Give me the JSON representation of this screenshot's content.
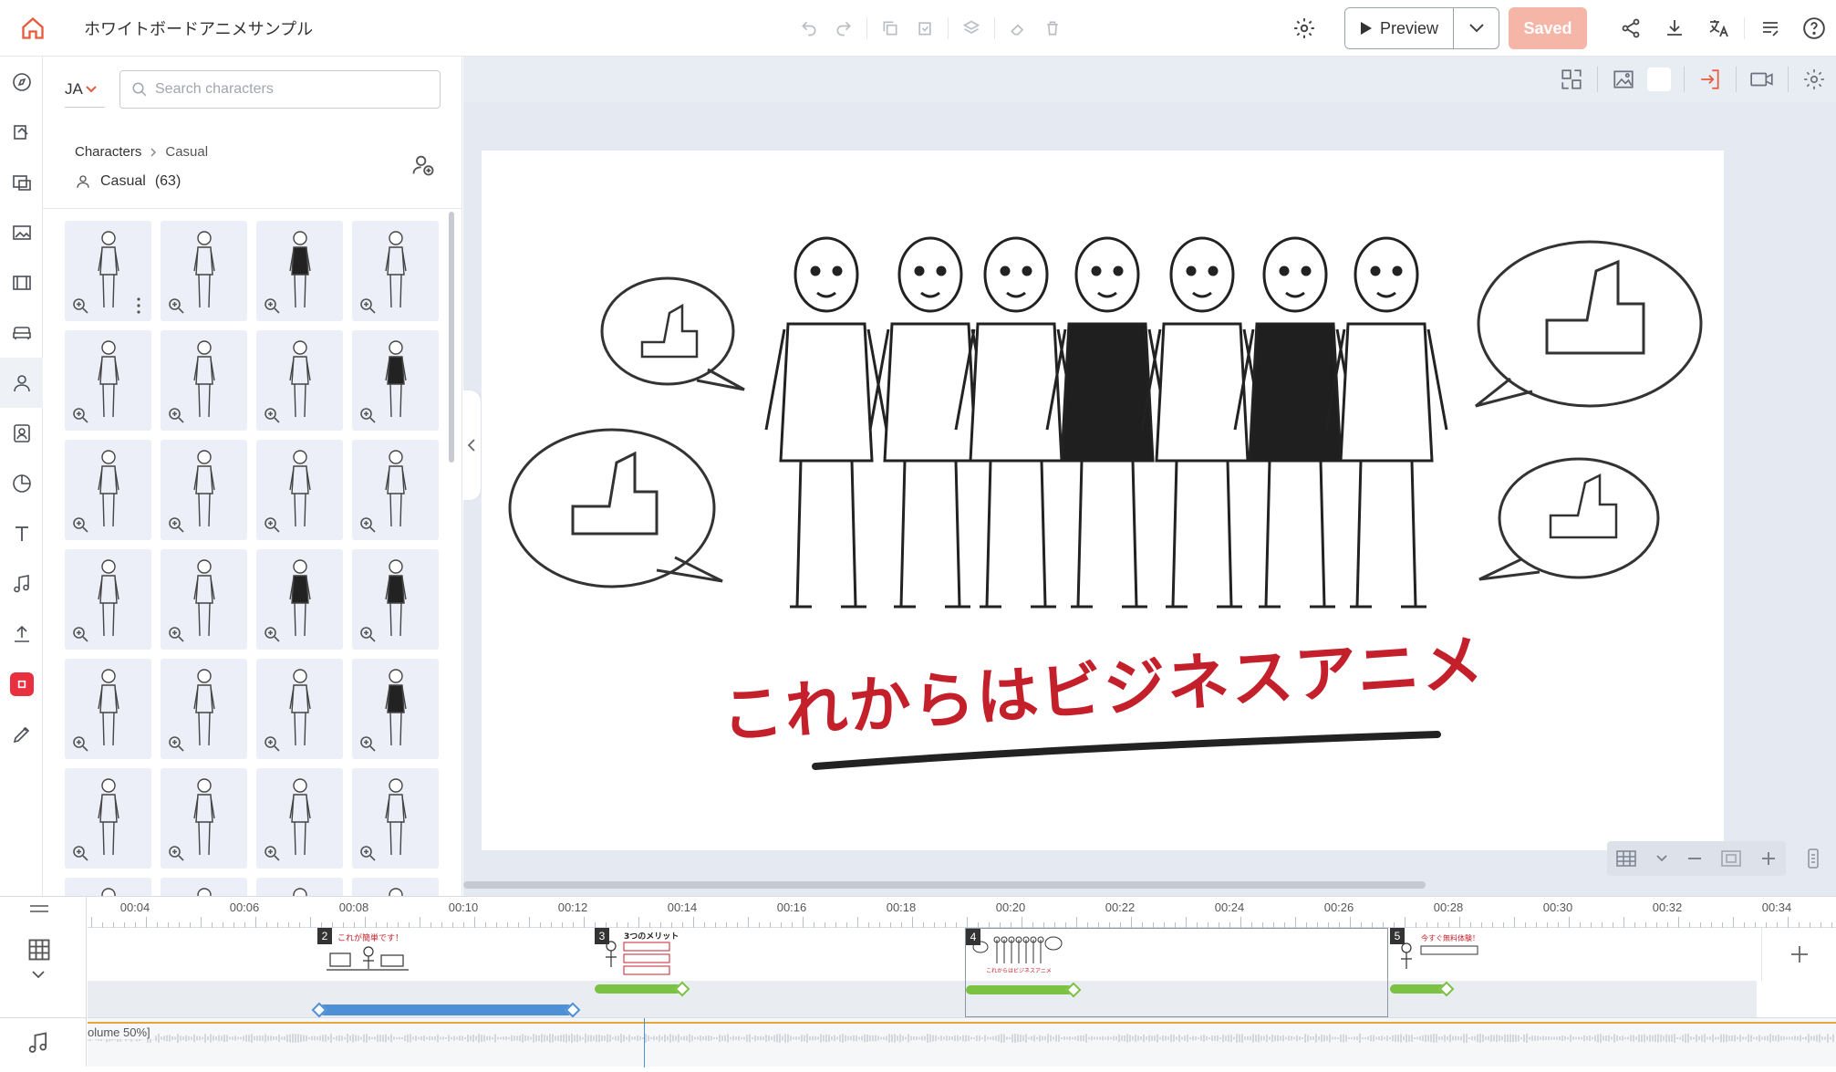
{
  "app": {
    "project_title": "ホワイトボードアニメサンプル",
    "preview_label": "Preview",
    "saved_label": "Saved",
    "accent_color": "#f5b6a8",
    "icons": [
      "home-icon",
      "undo-icon",
      "redo-icon",
      "copy-icon",
      "paste-icon",
      "layers-icon",
      "eraser-icon",
      "trash-icon",
      "settings-icon",
      "play-icon",
      "chevron-down-icon",
      "share-icon",
      "download-icon",
      "translate-icon",
      "notes-icon",
      "help-icon"
    ]
  },
  "library": {
    "language": "JA",
    "search_placeholder": "Search characters",
    "breadcrumb_root": "Characters",
    "breadcrumb_current": "Casual",
    "category_label": "Casual",
    "category_count": "(63)",
    "rail_icons": [
      "compass-icon",
      "brush-icon",
      "scene-icon",
      "image-icon",
      "video-icon",
      "sofa-icon",
      "character-icon",
      "portrait-icon",
      "chart-icon",
      "text-icon",
      "music-icon",
      "upload-icon",
      "app-icon",
      "pen-icon"
    ]
  },
  "stage": {
    "title": "これからはビジネスアニメ"
  },
  "timeline": {
    "ticks": [
      "00:04",
      "00:06",
      "00:08",
      "00:10",
      "00:12",
      "00:14",
      "00:16",
      "00:18",
      "00:20",
      "00:22",
      "00:24",
      "00:26",
      "00:28",
      "00:30",
      "00:32",
      "00:34"
    ],
    "scenes": [
      {
        "number": "2",
        "heading": "これが簡単です！"
      },
      {
        "number": "3",
        "heading": "3つのメリット"
      },
      {
        "number": "4",
        "heading": "これからはビジネスアニメ"
      },
      {
        "number": "5",
        "heading": "今すぐ無料体験！"
      }
    ],
    "audio_label": "olume 50%]"
  }
}
